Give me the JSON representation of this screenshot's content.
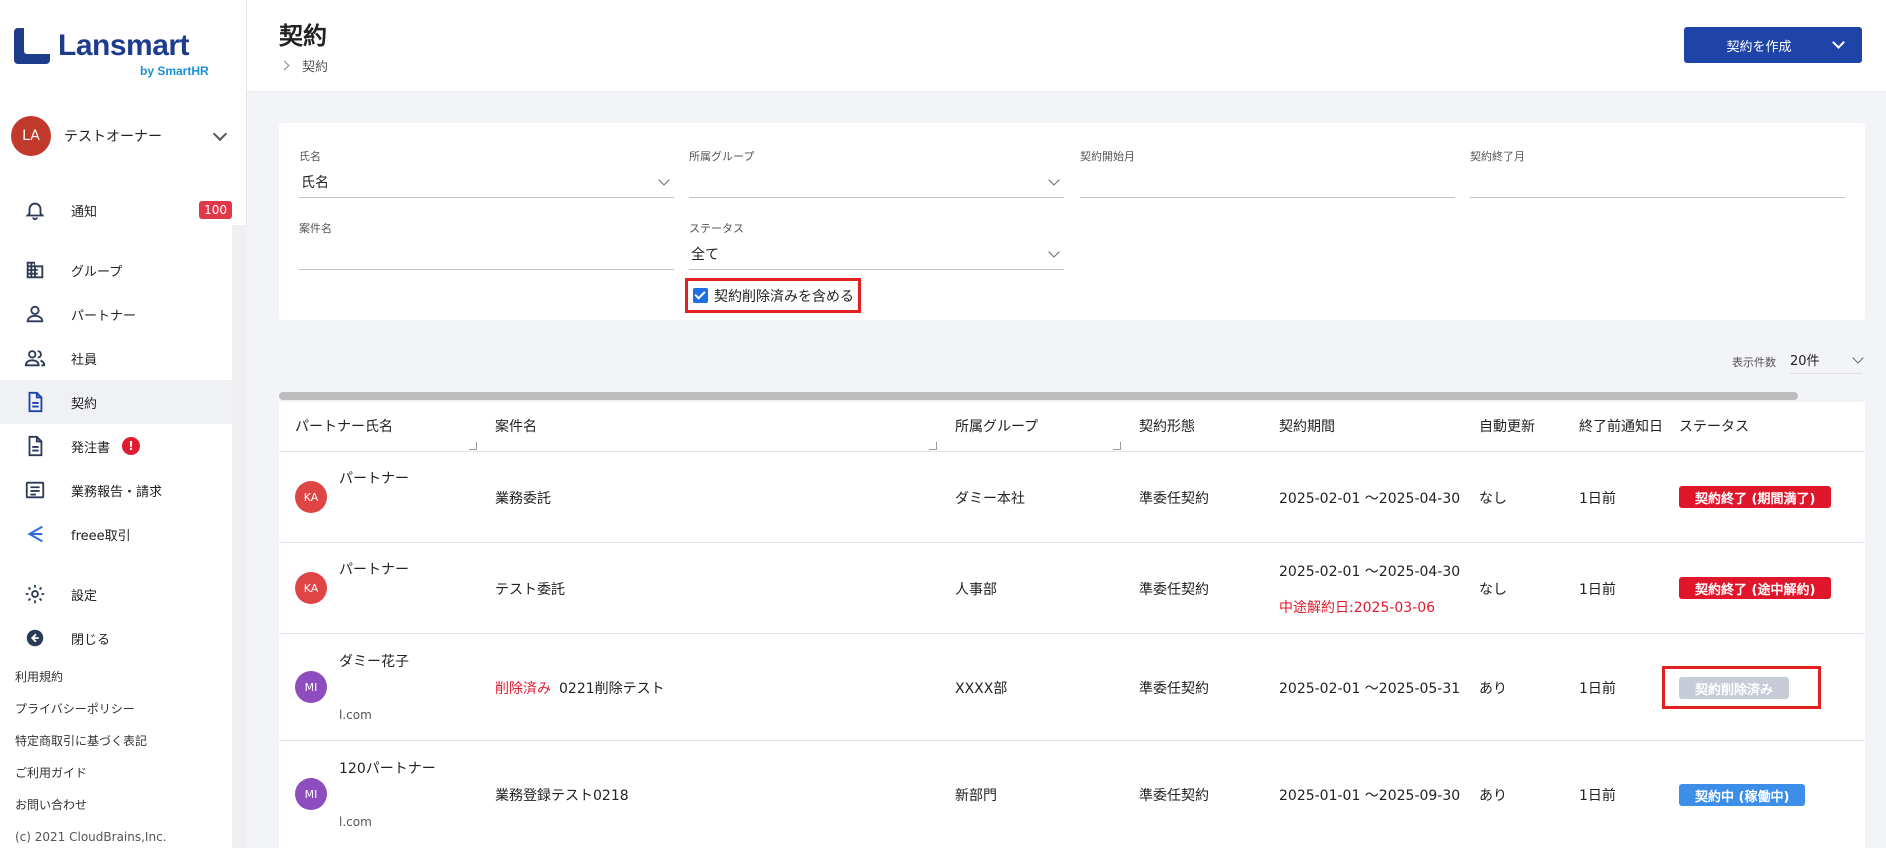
{
  "brand": {
    "name": "Lansmart",
    "sub": "by SmartHR"
  },
  "user": {
    "initials": "LA",
    "name": "テストオーナー"
  },
  "nav": {
    "notifications": {
      "label": "通知",
      "count": "100"
    },
    "groups": "グループ",
    "partners": "パートナー",
    "employees": "社員",
    "contracts": "契約",
    "orders": {
      "label": "発注書",
      "alert": "!"
    },
    "reports": "業務報告・請求",
    "freee": "freee取引",
    "settings": "設定",
    "close": "閉じる"
  },
  "footer": {
    "links": [
      "利用規約",
      "プライバシーポリシー",
      "特定商取引に基づく表記",
      "ご利用ガイド",
      "お問い合わせ"
    ],
    "copyright": "(c) 2021 CloudBrains,Inc."
  },
  "header": {
    "title": "契約",
    "breadcrumb": "契約",
    "create_button": "契約を作成"
  },
  "filters": {
    "name": {
      "label": "氏名",
      "value": "氏名"
    },
    "group": {
      "label": "所属グループ",
      "value": ""
    },
    "start_month": {
      "label": "契約開始月",
      "value": ""
    },
    "end_month": {
      "label": "契約終了月",
      "value": ""
    },
    "project": {
      "label": "案件名",
      "value": ""
    },
    "status": {
      "label": "ステータス",
      "value": "全て"
    },
    "include_deleted": {
      "label": "契約削除済みを含める",
      "checked": true
    }
  },
  "per_page": {
    "label": "表示件数",
    "value": "20件"
  },
  "table": {
    "columns": [
      "パートナー氏名",
      "案件名",
      "所属グループ",
      "契約形態",
      "契約期間",
      "自動更新",
      "終了前通知日",
      "ステータス"
    ],
    "rows": [
      {
        "initials": "KA",
        "avatar_color": "#e04545",
        "partner": "パートナー",
        "email": "",
        "deleted_tag": "",
        "project": "業務委託",
        "group": "ダミー本社",
        "type": "準委任契約",
        "period": "2025-02-01 〜2025-04-30",
        "note": "",
        "auto_renew": "なし",
        "notice": "1日前",
        "status": "契約終了 (期間満了)",
        "status_color": "red"
      },
      {
        "initials": "KA",
        "avatar_color": "#e04545",
        "partner": "パートナー",
        "email": "",
        "deleted_tag": "",
        "project": "テスト委託",
        "group": "人事部",
        "type": "準委任契約",
        "period": "2025-02-01 〜2025-04-30",
        "note": "中途解約日:2025-03-06",
        "auto_renew": "なし",
        "notice": "1日前",
        "status": "契約終了 (途中解約)",
        "status_color": "red"
      },
      {
        "initials": "MI",
        "avatar_color": "#8e4dbf",
        "partner": "ダミー花子",
        "email": "l.com",
        "deleted_tag": "削除済み",
        "project": "0221削除テスト",
        "group": "XXXX部",
        "type": "準委任契約",
        "period": "2025-02-01 〜2025-05-31",
        "note": "",
        "auto_renew": "あり",
        "notice": "1日前",
        "status": "契約削除済み",
        "status_color": "gray"
      },
      {
        "initials": "MI",
        "avatar_color": "#8e4dbf",
        "partner": "120パートナー",
        "email": "l.com",
        "deleted_tag": "",
        "project": "業務登録テスト0218",
        "group": "新部門",
        "type": "準委任契約",
        "period": "2025-01-01 〜2025-09-30",
        "note": "",
        "auto_renew": "あり",
        "notice": "1日前",
        "status": "契約中 (稼働中)",
        "status_color": "blue"
      }
    ]
  }
}
